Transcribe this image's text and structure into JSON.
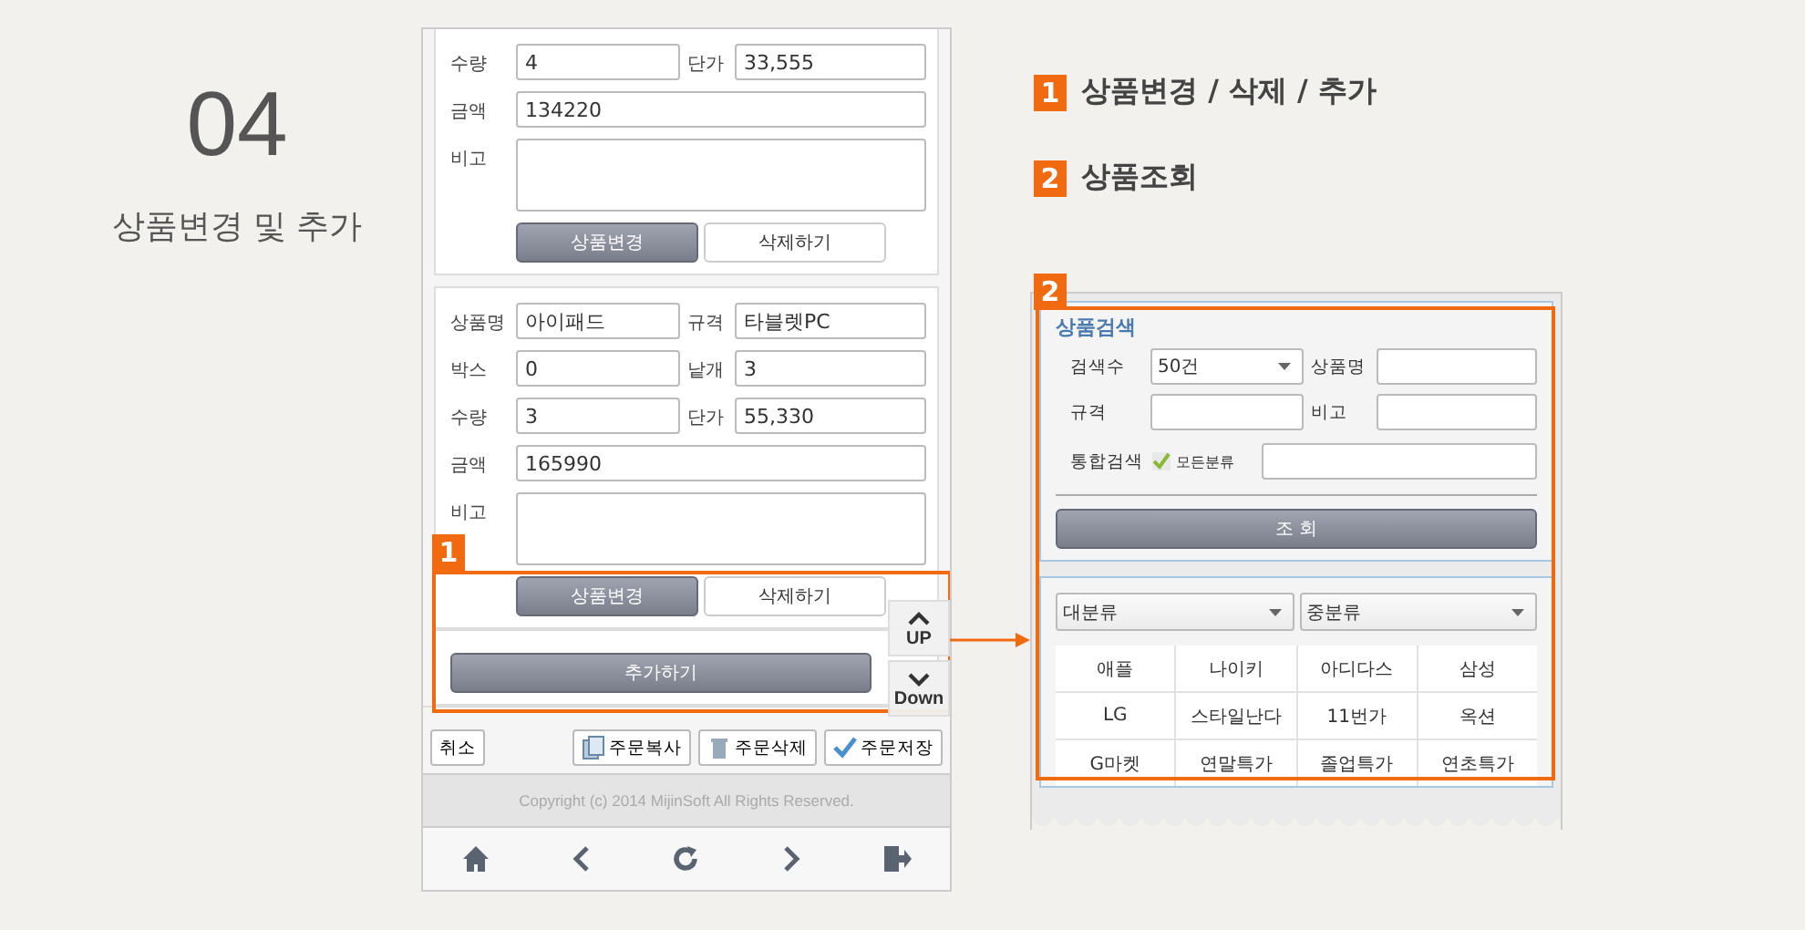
{
  "section": {
    "number": "04",
    "title": "상품변경 및 추가"
  },
  "legend": [
    {
      "badge": "1",
      "text": "상품변경 / 삭제 / 추가"
    },
    {
      "badge": "2",
      "text": "상품조회"
    }
  ],
  "phone": {
    "cards": [
      {
        "rows": [
          [
            {
              "label": "수량",
              "value": "4"
            },
            {
              "label": "단가",
              "value": "33,555"
            }
          ],
          [
            {
              "label": "금액",
              "value": "134220"
            }
          ],
          [
            {
              "label": "비고",
              "kind": "textarea"
            }
          ]
        ],
        "buttons": [
          {
            "label": "상품변경",
            "kind": "dark"
          },
          {
            "label": "삭제하기",
            "kind": "light"
          }
        ]
      },
      {
        "rows": [
          [
            {
              "label": "상품명",
              "value": "아이패드"
            },
            {
              "label": "규격",
              "value": "타블렛PC"
            }
          ],
          [
            {
              "label": "박스",
              "value": "0"
            },
            {
              "label": "낱개",
              "value": "3"
            }
          ],
          [
            {
              "label": "수량",
              "value": "3"
            },
            {
              "label": "단가",
              "value": "55,330"
            }
          ],
          [
            {
              "label": "금액",
              "value": "165990"
            }
          ],
          [
            {
              "label": "비고",
              "kind": "textarea"
            }
          ]
        ],
        "buttons": [
          {
            "label": "상품변경",
            "kind": "dark"
          },
          {
            "label": "삭제하기",
            "kind": "light"
          }
        ]
      }
    ],
    "add_button": "추가하기",
    "callout": "1",
    "scroll_buttons": [
      {
        "label": "UP",
        "kind": "up"
      },
      {
        "label": "Down",
        "kind": "down"
      }
    ],
    "actions": [
      {
        "label": "취소",
        "kind": "plain"
      },
      {
        "label": "주문복사",
        "kind": "copy"
      },
      {
        "label": "주문삭제",
        "kind": "trash"
      },
      {
        "label": "주문저장",
        "kind": "check"
      }
    ],
    "copyright": "Copyright (c) 2014 MijinSoft All Rights Reserved.",
    "nav": [
      {
        "kind": "home"
      },
      {
        "kind": "back"
      },
      {
        "kind": "refresh"
      },
      {
        "kind": "forward"
      },
      {
        "kind": "exit"
      }
    ]
  },
  "search_panel": {
    "callout": "2",
    "title": "상품검색",
    "count": {
      "label": "검색수",
      "value": "50건"
    },
    "name": {
      "label": "상품명"
    },
    "spec": {
      "label": "규격"
    },
    "memo": {
      "label": "비고"
    },
    "all": {
      "label": "통합검색",
      "option": "모든분류",
      "checked": true
    },
    "button": "조 회",
    "selects": [
      "대분류",
      "중분류"
    ],
    "brands": [
      "애플",
      "나이키",
      "아디다스",
      "삼성",
      "LG",
      "스타일난다",
      "11번가",
      "옥션",
      "G마켓",
      "연말특가",
      "졸업특가",
      "연초특가"
    ]
  }
}
